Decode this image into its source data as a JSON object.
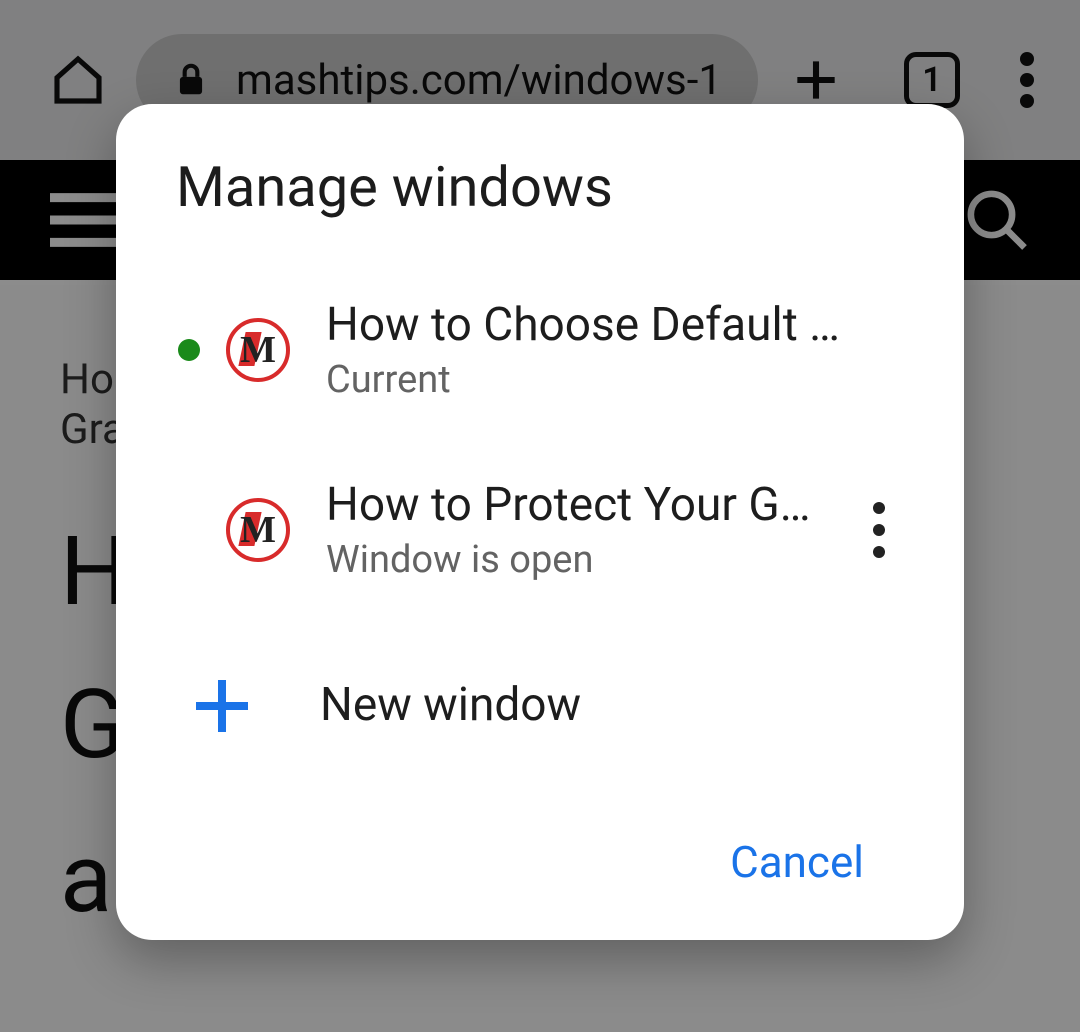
{
  "toolbar": {
    "url_display": "mashtips.com/windows-1",
    "tab_count": "1"
  },
  "site": {
    "breadcrumb_line1": "Hon",
    "breadcrumb_line2": "Gra",
    "title_line1": "H",
    "title_line2": "G",
    "title_line3": "ar"
  },
  "dialog": {
    "title": "Manage windows",
    "windows": [
      {
        "title": "How to Choose Default …",
        "status": "Current",
        "is_current": true,
        "has_menu": false
      },
      {
        "title": "How to Protect Your Go…",
        "status": "Window is open",
        "is_current": false,
        "has_menu": true
      }
    ],
    "new_window_label": "New window",
    "cancel_label": "Cancel"
  },
  "favicon_glyph": "M"
}
